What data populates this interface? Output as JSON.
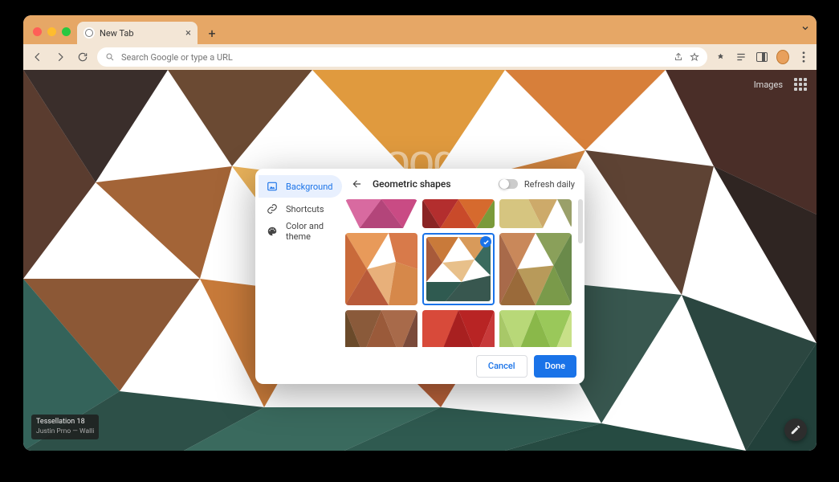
{
  "tab": {
    "title": "New Tab"
  },
  "omnibox": {
    "placeholder": "Search Google or type a URL"
  },
  "header_links": {
    "images": "Images"
  },
  "logo": "Google",
  "attribution": {
    "title": "Tessellation 18",
    "subtitle": "Justin Prno — Walli"
  },
  "dialog": {
    "title": "Geometric shapes",
    "refresh_label": "Refresh daily",
    "sidebar": {
      "background": "Background",
      "shortcuts": "Shortcuts",
      "color_theme": "Color and theme"
    },
    "footer": {
      "cancel": "Cancel",
      "done": "Done"
    }
  }
}
